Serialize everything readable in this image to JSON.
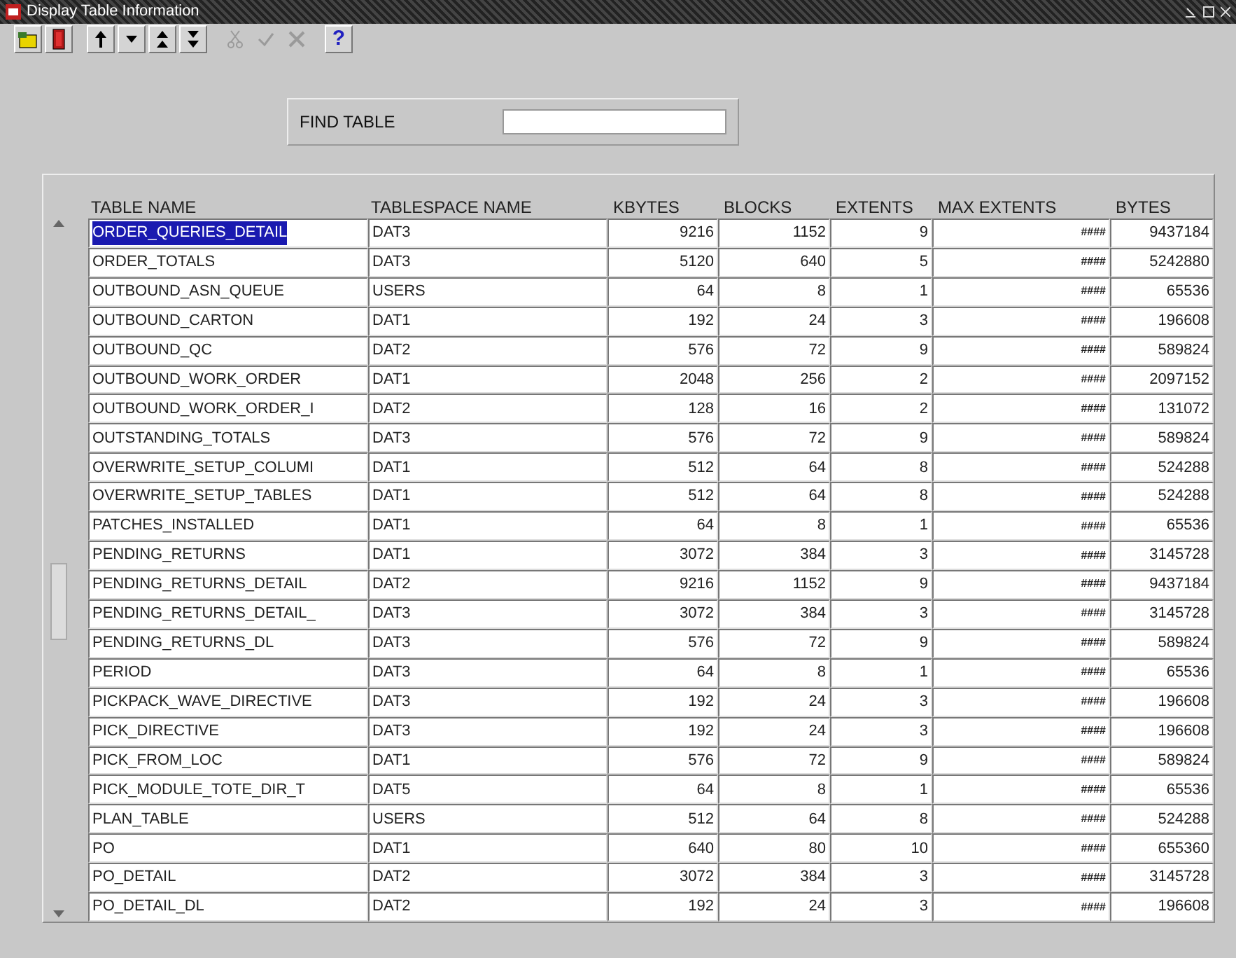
{
  "window": {
    "title": "Display Table Information"
  },
  "toolbar": [
    {
      "kind": "save",
      "disabled": false
    },
    {
      "kind": "exit",
      "disabled": false
    },
    {
      "kind": "up",
      "disabled": false
    },
    {
      "kind": "down",
      "disabled": false
    },
    {
      "kind": "prev",
      "disabled": false
    },
    {
      "kind": "next",
      "disabled": false
    },
    {
      "kind": "cut",
      "disabled": true
    },
    {
      "kind": "check",
      "disabled": true
    },
    {
      "kind": "delete",
      "disabled": true
    },
    {
      "kind": "help",
      "disabled": false,
      "label": "?"
    }
  ],
  "find": {
    "label": "FIND TABLE"
  },
  "table": {
    "columns": [
      "TABLE NAME",
      "TABLESPACE NAME",
      "KBYTES",
      "BLOCKS",
      "EXTENTS",
      "MAX EXTENTS",
      "BYTES"
    ],
    "rows": [
      {
        "selected": true,
        "cells": [
          "ORDER_QUERIES_DETAIL",
          "DAT3",
          "9216",
          "1152",
          "9",
          "####",
          "9437184"
        ]
      },
      {
        "selected": false,
        "cells": [
          "ORDER_TOTALS",
          "DAT3",
          "5120",
          "640",
          "5",
          "####",
          "5242880"
        ]
      },
      {
        "selected": false,
        "cells": [
          "OUTBOUND_ASN_QUEUE",
          "USERS",
          "64",
          "8",
          "1",
          "####",
          "65536"
        ]
      },
      {
        "selected": false,
        "cells": [
          "OUTBOUND_CARTON",
          "DAT1",
          "192",
          "24",
          "3",
          "####",
          "196608"
        ]
      },
      {
        "selected": false,
        "cells": [
          "OUTBOUND_QC",
          "DAT2",
          "576",
          "72",
          "9",
          "####",
          "589824"
        ]
      },
      {
        "selected": false,
        "cells": [
          "OUTBOUND_WORK_ORDER",
          "DAT1",
          "2048",
          "256",
          "2",
          "####",
          "2097152"
        ]
      },
      {
        "selected": false,
        "cells": [
          "OUTBOUND_WORK_ORDER_I",
          "DAT2",
          "128",
          "16",
          "2",
          "####",
          "131072"
        ]
      },
      {
        "selected": false,
        "cells": [
          "OUTSTANDING_TOTALS",
          "DAT3",
          "576",
          "72",
          "9",
          "####",
          "589824"
        ]
      },
      {
        "selected": false,
        "cells": [
          "OVERWRITE_SETUP_COLUMI",
          "DAT1",
          "512",
          "64",
          "8",
          "####",
          "524288"
        ]
      },
      {
        "selected": false,
        "cells": [
          "OVERWRITE_SETUP_TABLES",
          "DAT1",
          "512",
          "64",
          "8",
          "####",
          "524288"
        ]
      },
      {
        "selected": false,
        "cells": [
          "PATCHES_INSTALLED",
          "DAT1",
          "64",
          "8",
          "1",
          "####",
          "65536"
        ]
      },
      {
        "selected": false,
        "cells": [
          "PENDING_RETURNS",
          "DAT1",
          "3072",
          "384",
          "3",
          "####",
          "3145728"
        ]
      },
      {
        "selected": false,
        "cells": [
          "PENDING_RETURNS_DETAIL",
          "DAT2",
          "9216",
          "1152",
          "9",
          "####",
          "9437184"
        ]
      },
      {
        "selected": false,
        "cells": [
          "PENDING_RETURNS_DETAIL_",
          "DAT3",
          "3072",
          "384",
          "3",
          "####",
          "3145728"
        ]
      },
      {
        "selected": false,
        "cells": [
          "PENDING_RETURNS_DL",
          "DAT3",
          "576",
          "72",
          "9",
          "####",
          "589824"
        ]
      },
      {
        "selected": false,
        "cells": [
          "PERIOD",
          "DAT3",
          "64",
          "8",
          "1",
          "####",
          "65536"
        ]
      },
      {
        "selected": false,
        "cells": [
          "PICKPACK_WAVE_DIRECTIVE",
          "DAT3",
          "192",
          "24",
          "3",
          "####",
          "196608"
        ]
      },
      {
        "selected": false,
        "cells": [
          "PICK_DIRECTIVE",
          "DAT3",
          "192",
          "24",
          "3",
          "####",
          "196608"
        ]
      },
      {
        "selected": false,
        "cells": [
          "PICK_FROM_LOC",
          "DAT1",
          "576",
          "72",
          "9",
          "####",
          "589824"
        ]
      },
      {
        "selected": false,
        "cells": [
          "PICK_MODULE_TOTE_DIR_T",
          "DAT5",
          "64",
          "8",
          "1",
          "####",
          "65536"
        ]
      },
      {
        "selected": false,
        "cells": [
          "PLAN_TABLE",
          "USERS",
          "512",
          "64",
          "8",
          "####",
          "524288"
        ]
      },
      {
        "selected": false,
        "cells": [
          "PO",
          "DAT1",
          "640",
          "80",
          "10",
          "####",
          "655360"
        ]
      },
      {
        "selected": false,
        "cells": [
          "PO_DETAIL",
          "DAT2",
          "3072",
          "384",
          "3",
          "####",
          "3145728"
        ]
      },
      {
        "selected": false,
        "cells": [
          "PO_DETAIL_DL",
          "DAT2",
          "192",
          "24",
          "3",
          "####",
          "196608"
        ]
      }
    ]
  }
}
